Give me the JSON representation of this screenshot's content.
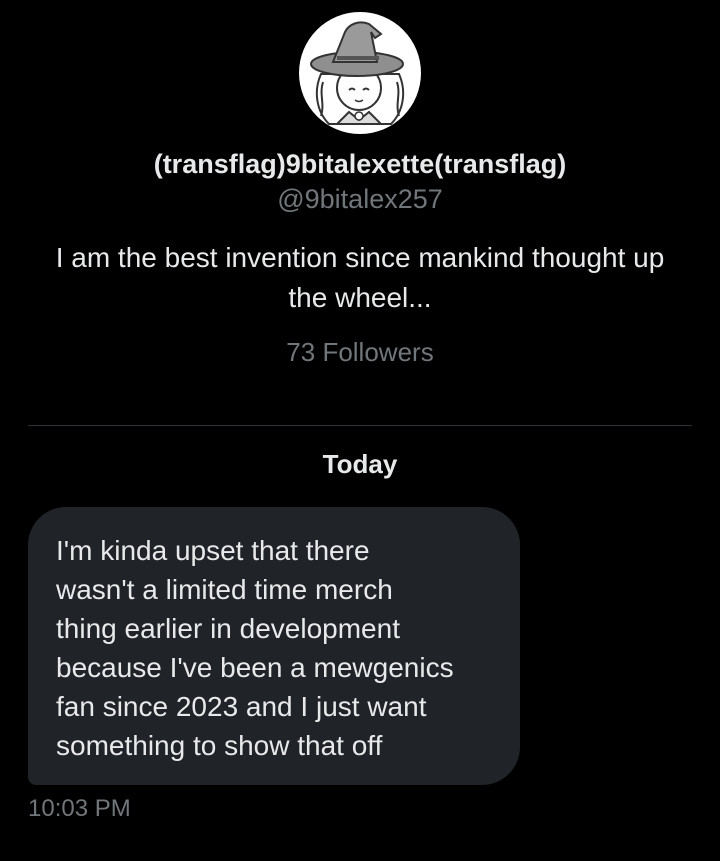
{
  "profile": {
    "display_name": "(transflag)9bitalexette(transflag)",
    "handle": "@9bitalex257",
    "bio": "I am the best invention since mankind thought up the wheel...",
    "followers": "73 Followers"
  },
  "conversation": {
    "date_separator": "Today",
    "messages": [
      {
        "text": "I'm kinda upset that there\nwasn't a limited time merch\nthing earlier in development\nbecause I've been a mewgenics\nfan since 2023 and I just want\nsomething to show that off",
        "time": "10:03 PM"
      }
    ]
  },
  "colors": {
    "background": "#000000",
    "primary_text": "#e7e9ea",
    "secondary_text": "#71767b",
    "bubble": "#202327",
    "divider": "#2f3336"
  }
}
